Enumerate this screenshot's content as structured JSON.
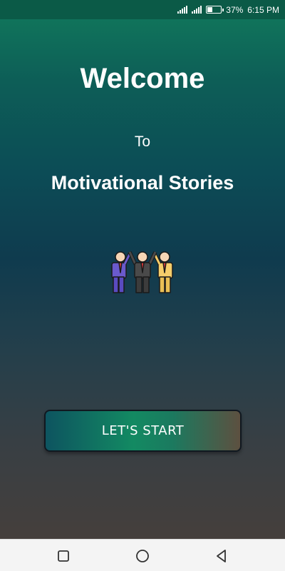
{
  "status_bar": {
    "battery_percent": "37%",
    "battery_level": 0.37,
    "time": "6:15 PM"
  },
  "welcome_title": "Welcome",
  "to_text": "To",
  "app_name": "Motivational Stories",
  "illustration": "team-celebration-icon",
  "start_button_label": "LET'S  START",
  "navigation": {
    "recent_icon": "square-icon",
    "home_icon": "circle-icon",
    "back_icon": "triangle-back-icon"
  },
  "colors": {
    "status_bar": "#0b5a47",
    "gradient_top": "#117a5c",
    "gradient_mid": "#0f3b4e",
    "gradient_bottom": "#453f3c",
    "text": "#ffffff"
  }
}
